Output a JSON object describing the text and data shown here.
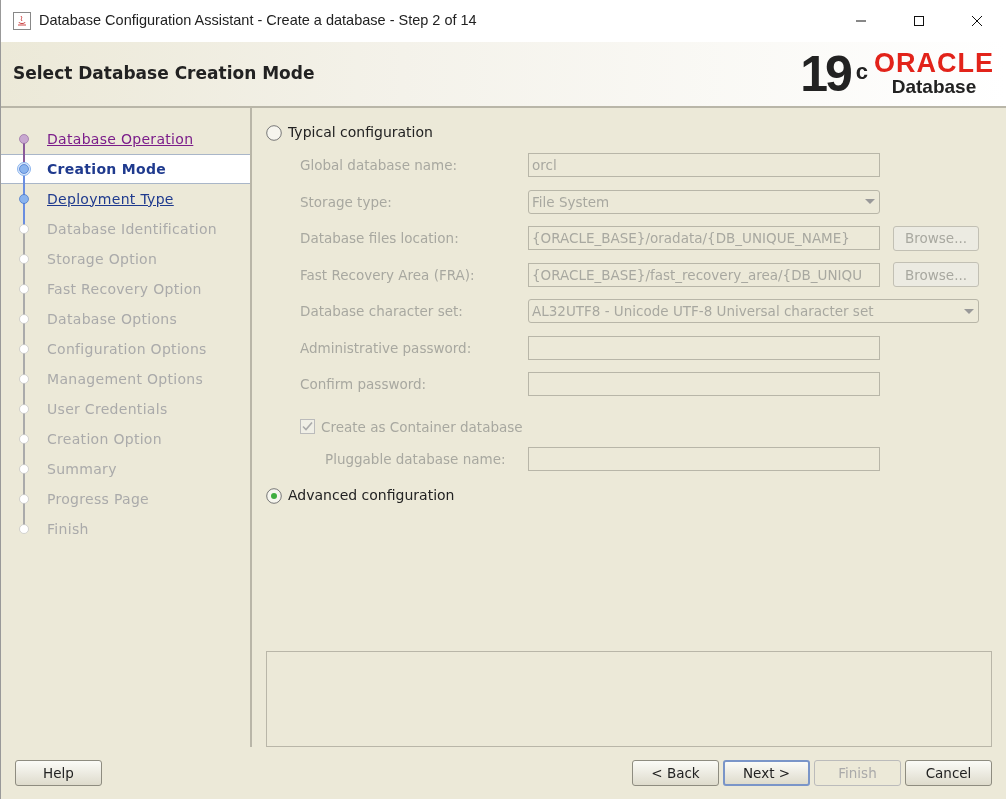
{
  "window": {
    "title": "Database Configuration Assistant - Create a database - Step 2 of 14"
  },
  "header": {
    "title": "Select Database Creation Mode",
    "logo_version": "19",
    "logo_sup": "c",
    "logo_brand": "ORACLE",
    "logo_product": "Database"
  },
  "steps": [
    {
      "label": "Database Operation",
      "kind": "visited",
      "selected": false
    },
    {
      "label": "Creation Mode",
      "kind": "current",
      "selected": true
    },
    {
      "label": "Deployment Type",
      "kind": "available",
      "selected": false
    },
    {
      "label": "Database Identification",
      "kind": "pending",
      "selected": false
    },
    {
      "label": "Storage Option",
      "kind": "pending",
      "selected": false
    },
    {
      "label": "Fast Recovery Option",
      "kind": "pending",
      "selected": false
    },
    {
      "label": "Database Options",
      "kind": "pending",
      "selected": false
    },
    {
      "label": "Configuration Options",
      "kind": "pending",
      "selected": false
    },
    {
      "label": "Management Options",
      "kind": "pending",
      "selected": false
    },
    {
      "label": "User Credentials",
      "kind": "pending",
      "selected": false
    },
    {
      "label": "Creation Option",
      "kind": "pending",
      "selected": false
    },
    {
      "label": "Summary",
      "kind": "pending",
      "selected": false
    },
    {
      "label": "Progress Page",
      "kind": "pending",
      "selected": false
    },
    {
      "label": "Finish",
      "kind": "pending",
      "selected": false
    }
  ],
  "typical": {
    "label": "Typical configuration",
    "selected": false
  },
  "fields": [
    {
      "label": "Global database name:",
      "kind": "text",
      "value": "orcl"
    },
    {
      "label": "Storage type:",
      "kind": "select",
      "value": "File System"
    },
    {
      "label": "Database files location:",
      "kind": "text",
      "value": "{ORACLE_BASE}/oradata/{DB_UNIQUE_NAME}",
      "button": "Browse..."
    },
    {
      "label": "Fast Recovery Area (FRA):",
      "kind": "text",
      "value": "{ORACLE_BASE}/fast_recovery_area/{DB_UNIQU",
      "button": "Browse..."
    },
    {
      "label": "Database character set:",
      "kind": "wideselect",
      "value": "AL32UTF8 - Unicode UTF-8 Universal character set"
    },
    {
      "label": "Administrative password:",
      "kind": "text"
    },
    {
      "label": "Confirm password:",
      "kind": "text"
    }
  ],
  "container": {
    "label": "Create as Container database",
    "checked": true,
    "disabled": true
  },
  "pluggable": {
    "label": "Pluggable database name:"
  },
  "advanced": {
    "label": "Advanced configuration",
    "selected": true
  },
  "left_buttons": [
    {
      "label": "Help",
      "disabled": false,
      "focused": false
    }
  ],
  "right_buttons": [
    {
      "label": "< Back",
      "disabled": false,
      "focused": false
    },
    {
      "label": "Next >",
      "disabled": false,
      "focused": true
    },
    {
      "label": "Finish",
      "disabled": true,
      "focused": false
    },
    {
      "label": "Cancel",
      "disabled": false,
      "focused": false
    }
  ]
}
